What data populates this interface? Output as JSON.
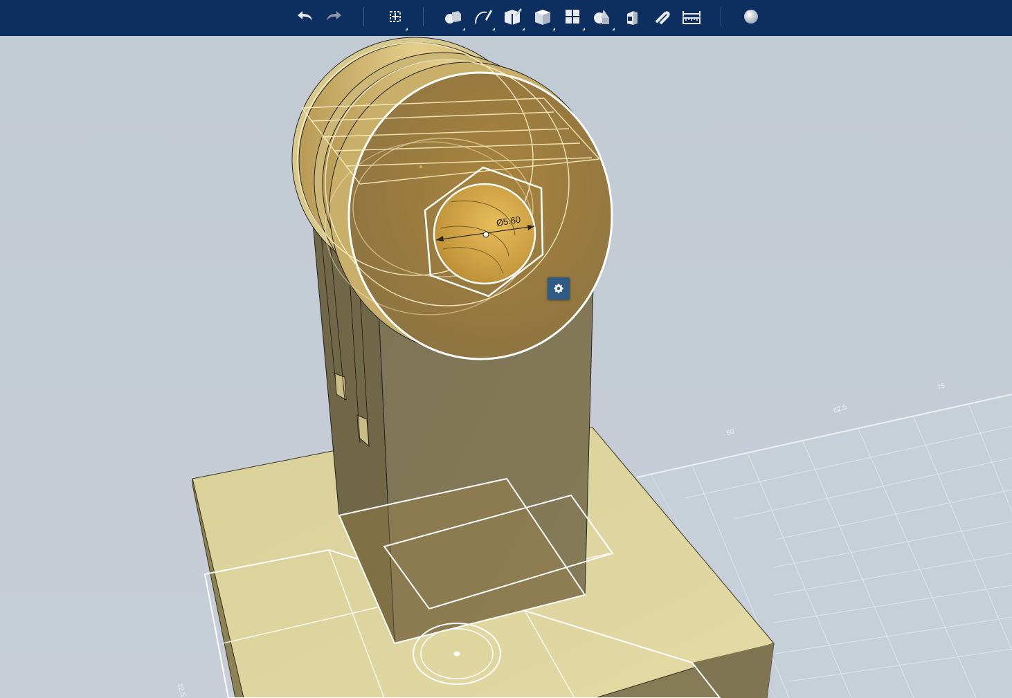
{
  "toolbar": {
    "undo_icon": "undo-arrow-icon",
    "redo_icon": "redo-arrow-icon",
    "buttons": [
      {
        "name": "transform-icon"
      },
      {
        "name": "primitives-icon"
      },
      {
        "name": "sketch-icon"
      },
      {
        "name": "construct-icon"
      },
      {
        "name": "modify-icon"
      },
      {
        "name": "pattern-icon"
      },
      {
        "name": "grouping-icon"
      },
      {
        "name": "combine-icon"
      },
      {
        "name": "snap-icon"
      },
      {
        "name": "measure-icon"
      },
      {
        "name": "material-icon"
      }
    ],
    "background_color": "#0d2f5f"
  },
  "viewport": {
    "dimension_label": "Ø5.60",
    "grid_labels": [
      "75",
      "62.5",
      "50",
      "12.5"
    ],
    "background_color": "#c5cdd6",
    "model_color": "#d9cf98",
    "selected_face_color": "#b8954a"
  }
}
